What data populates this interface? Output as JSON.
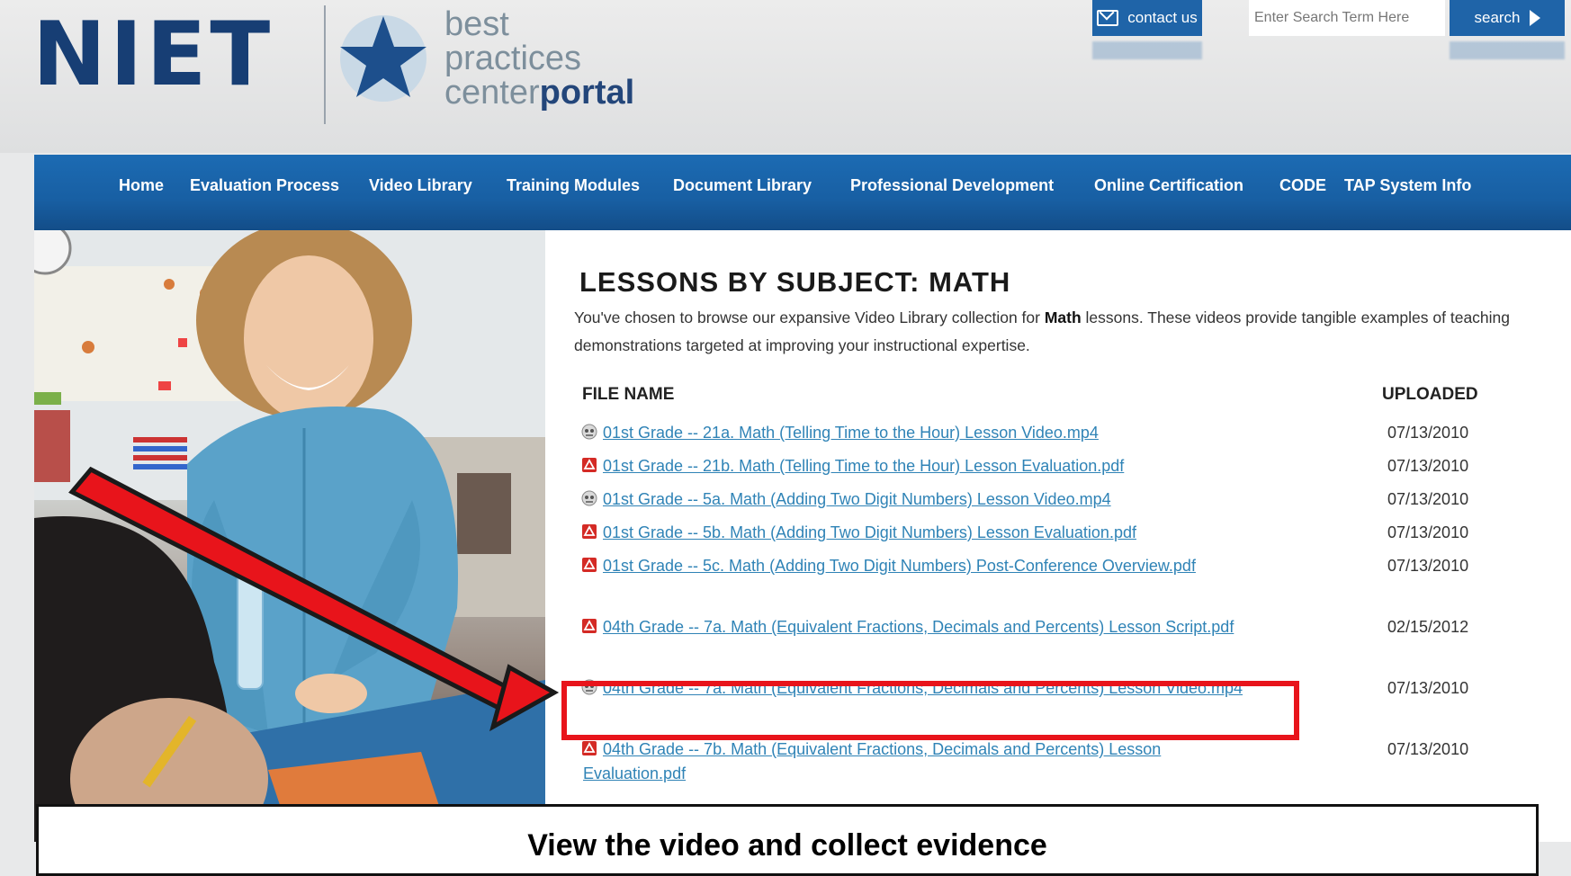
{
  "brand": {
    "logo": "NIET",
    "tagline_line1": "best",
    "tagline_line2": "practices",
    "tagline_line3_a": "center",
    "tagline_line3_b": "portal"
  },
  "header": {
    "contact_label": "contact us",
    "search_placeholder": "Enter Search Term Here",
    "search_label": "search"
  },
  "nav": {
    "items": [
      "Home",
      "Evaluation Process",
      "Video Library",
      "Training Modules",
      "Document Library",
      "Professional Development",
      "Online Certification",
      "CODE",
      "TAP System Info"
    ]
  },
  "main": {
    "title": "LESSONS BY SUBJECT: MATH",
    "intro_before": "You've chosen to browse our expansive Video Library collection for ",
    "intro_bold": "Math",
    "intro_after": " lessons. These videos provide tangible examples of teaching demonstrations targeted at improving your instructional expertise.",
    "col_file": "FILE NAME",
    "col_uploaded": "UPLOADED",
    "files": [
      {
        "icon": "video-icon",
        "name": "01st Grade -- 21a. Math (Telling Time to the Hour) Lesson Video.mp4",
        "date": "07/13/2010"
      },
      {
        "icon": "pdf-icon",
        "name": "01st Grade -- 21b. Math (Telling Time to the Hour) Lesson Evaluation.pdf",
        "date": "07/13/2010"
      },
      {
        "icon": "video-icon",
        "name": "01st Grade -- 5a. Math (Adding Two Digit Numbers) Lesson Video.mp4",
        "date": "07/13/2010"
      },
      {
        "icon": "pdf-icon",
        "name": "01st Grade -- 5b. Math (Adding Two Digit Numbers) Lesson Evaluation.pdf",
        "date": "07/13/2010"
      },
      {
        "icon": "pdf-icon",
        "name": "01st Grade -- 5c. Math (Adding Two Digit Numbers) Post-Conference Overview.pdf",
        "date": "07/13/2010"
      },
      {
        "icon": "pdf-icon",
        "name": "04th Grade -- 7a. Math (Equivalent Fractions, Decimals and Percents) Lesson Script.pdf",
        "date": "02/15/2012"
      },
      {
        "icon": "video-icon",
        "name": "04th Grade -- 7a. Math (Equivalent Fractions, Decimals and Percents) Lesson Video.mp4",
        "date": "07/13/2010"
      },
      {
        "icon": "pdf-icon",
        "name": "04th Grade -- 7b. Math (Equivalent Fractions, Decimals and Percents) Lesson Evaluation.pdf",
        "date": "07/13/2010"
      }
    ]
  },
  "annotation": {
    "caption": "View the video and collect evidence",
    "highlight_color": "#e8141b"
  }
}
